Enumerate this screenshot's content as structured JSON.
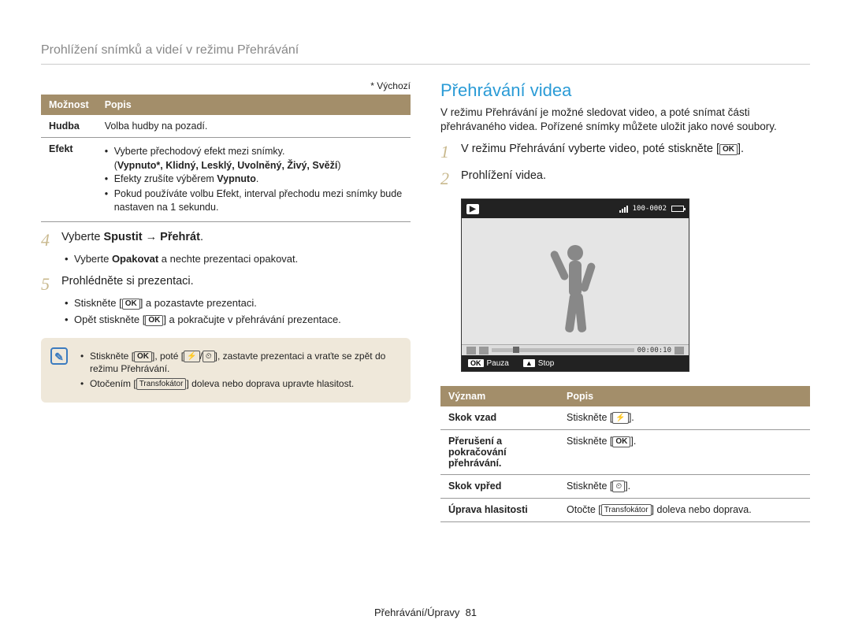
{
  "header": "Prohlížení snímků a videí v režimu Přehrávání",
  "left": {
    "default_label": "* Výchozí",
    "table": {
      "col_option": "Možnost",
      "col_desc": "Popis",
      "row1_label": "Hudba",
      "row1_desc": "Volba hudby na pozadí.",
      "row2_label": "Efekt",
      "b1": "Vyberte přechodový efekt mezi snímky.",
      "b2_prefix": "(",
      "b2_bold": "Vypnuto*, Klidný, Lesklý, Uvolněný, Živý, Svěží",
      "b2_suffix": ")",
      "b3_prefix": "Efekty zrušíte výběrem ",
      "b3_bold": "Vypnuto",
      "b3_suffix": ".",
      "b4": "Pokud používáte volbu Efekt, interval přechodu mezi snímky bude nastaven na 1 sekundu."
    },
    "step4": {
      "num": "4",
      "t1": "Vyberte ",
      "t2": "Spustit",
      "t3": " → ",
      "t4": "Přehrát",
      "t5": ".",
      "sub1_a": "Vyberte ",
      "sub1_b": "Opakovat",
      "sub1_c": " a nechte prezentaci opakovat."
    },
    "step5": {
      "num": "5",
      "text": "Prohlédněte si prezentaci.",
      "sub1_a": "Stiskněte [",
      "sub1_ok": "OK",
      "sub1_b": "] a pozastavte prezentaci.",
      "sub2_a": "Opět stiskněte [",
      "sub2_ok": "OK",
      "sub2_b": "] a pokračujte v přehrávání prezentace."
    },
    "note": {
      "li1_a": "Stiskněte [",
      "li1_ok": "OK",
      "li1_b": "], poté [",
      "li1_flash": "⚡",
      "li1_slash": "/",
      "li1_timer": "⏲",
      "li1_c": "], zastavte prezentaci a vraťte se zpět do režimu Přehrávání.",
      "li2_a": "Otočením [",
      "li2_btn": "Transfokátor",
      "li2_b": "] doleva nebo doprava upravte hlasitost."
    }
  },
  "right": {
    "title": "Přehrávání videa",
    "intro": "V režimu Přehrávání je možné sledovat video, a poté snímat části přehrávaného videa. Pořízené snímky můžete uložit jako nové soubory.",
    "step1": {
      "num": "1",
      "t1": "V režimu Přehrávání vyberte video, poté stiskněte [",
      "ok": "OK",
      "t2": "]."
    },
    "step2": {
      "num": "2",
      "text": "Prohlížení videa."
    },
    "video": {
      "counter": "100-0002",
      "time": "00:00:10",
      "footer_ok": "OK",
      "footer_pause": "Pauza",
      "footer_up": "▲",
      "footer_stop": "Stop"
    },
    "table": {
      "col_meaning": "Význam",
      "col_desc": "Popis",
      "r1_label": "Skok vzad",
      "r1_a": "Stiskněte [",
      "r1_icon": "⚡",
      "r1_b": "].",
      "r2_label": "Přerušení a pokračování přehrávání.",
      "r2_a": "Stiskněte [",
      "r2_ok": "OK",
      "r2_b": "].",
      "r3_label": "Skok vpřed",
      "r3_a": "Stiskněte [",
      "r3_icon": "⏲",
      "r3_b": "].",
      "r4_label": "Úprava hlasitosti",
      "r4_a": "Otočte [",
      "r4_btn": "Transfokátor",
      "r4_b": "] doleva nebo doprava."
    }
  },
  "footer": {
    "section": "Přehrávání/Úpravy",
    "page": "81"
  }
}
